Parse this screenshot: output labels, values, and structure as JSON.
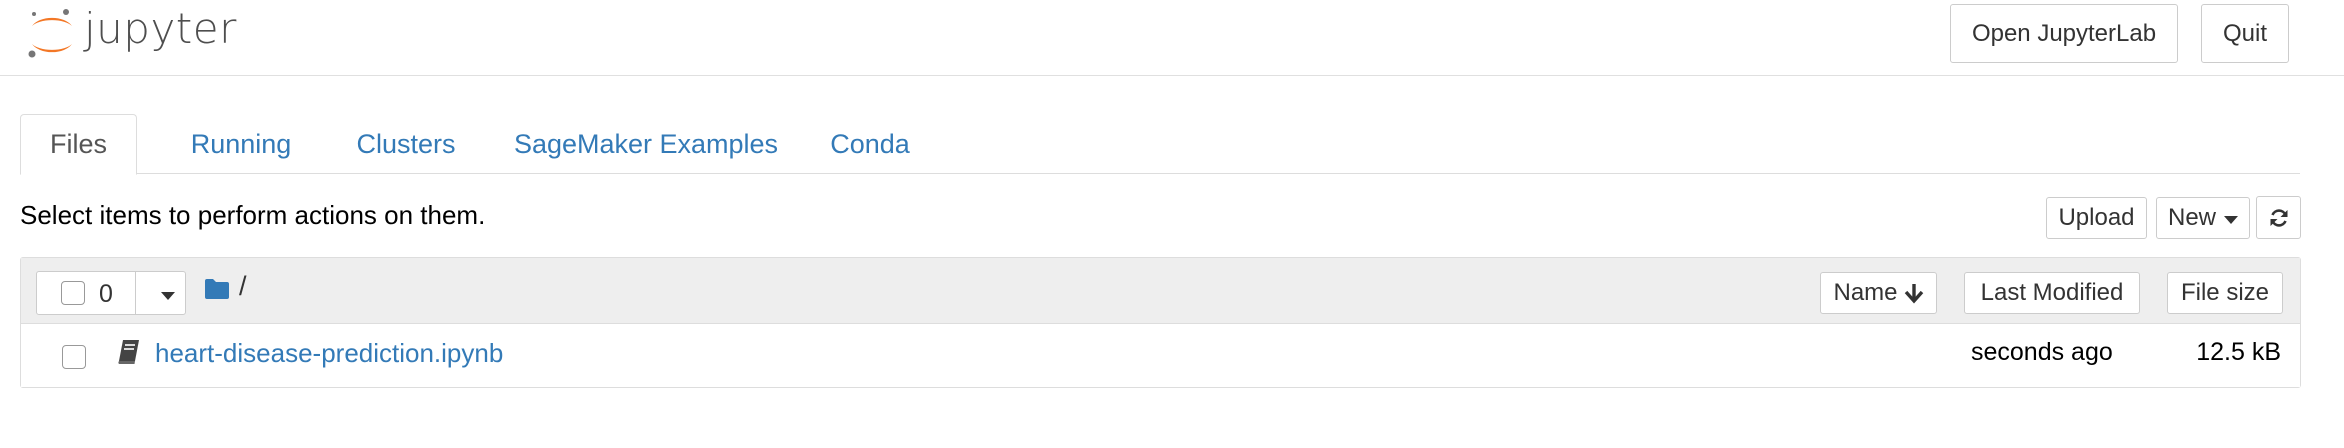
{
  "header": {
    "logo_text": "jupyter",
    "open_jupyterlab_label": "Open JupyterLab",
    "quit_label": "Quit"
  },
  "tabs": [
    {
      "label": "Files",
      "active": true
    },
    {
      "label": "Running",
      "active": false
    },
    {
      "label": "Clusters",
      "active": false
    },
    {
      "label": "SageMaker Examples",
      "active": false
    },
    {
      "label": "Conda",
      "active": false
    }
  ],
  "toolbar": {
    "instructions": "Select items to perform actions on them.",
    "upload_label": "Upload",
    "new_label": "New",
    "refresh_icon": "refresh-icon"
  },
  "list_header": {
    "selected_count": "0",
    "breadcrumb_root": "/",
    "sort_name_label": "Name",
    "sort_name_icon": "arrow-down-icon",
    "last_modified_label": "Last Modified",
    "file_size_label": "File size"
  },
  "files": [
    {
      "icon": "notebook-icon",
      "name": "heart-disease-prediction.ipynb",
      "modified": "seconds ago",
      "size": "12.5 kB"
    }
  ],
  "colors": {
    "link": "#337ab7",
    "logo_orange": "#f37726",
    "logo_gray": "#767677",
    "header_bg": "#eeeeee"
  }
}
